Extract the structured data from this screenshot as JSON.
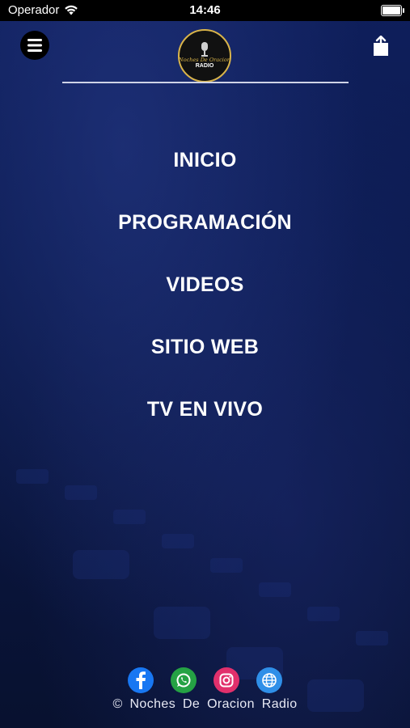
{
  "status_bar": {
    "carrier": "Operador",
    "time": "14:46"
  },
  "header": {
    "menu_icon": "hamburger-icon",
    "share_icon": "share-icon",
    "logo": {
      "line1": "Noches De Oracion",
      "line2": "RADIO"
    }
  },
  "menu": {
    "items": [
      {
        "label": "INICIO"
      },
      {
        "label": "PROGRAMACIÓN"
      },
      {
        "label": "VIDEOS"
      },
      {
        "label": "SITIO WEB"
      },
      {
        "label": "TV EN VIVO"
      }
    ]
  },
  "social": {
    "icons": [
      "facebook-icon",
      "whatsapp-icon",
      "instagram-icon",
      "globe-icon"
    ],
    "colors": {
      "facebook": "#1877f2",
      "whatsapp": "#25a244",
      "instagram": "#e1306c",
      "globe": "#2f8fe8"
    }
  },
  "footer": {
    "text": "© Noches De Oracion Radio"
  },
  "colors": {
    "background": "#0b1a4e",
    "text": "#ffffff",
    "logo_ring": "#d9b44a"
  }
}
